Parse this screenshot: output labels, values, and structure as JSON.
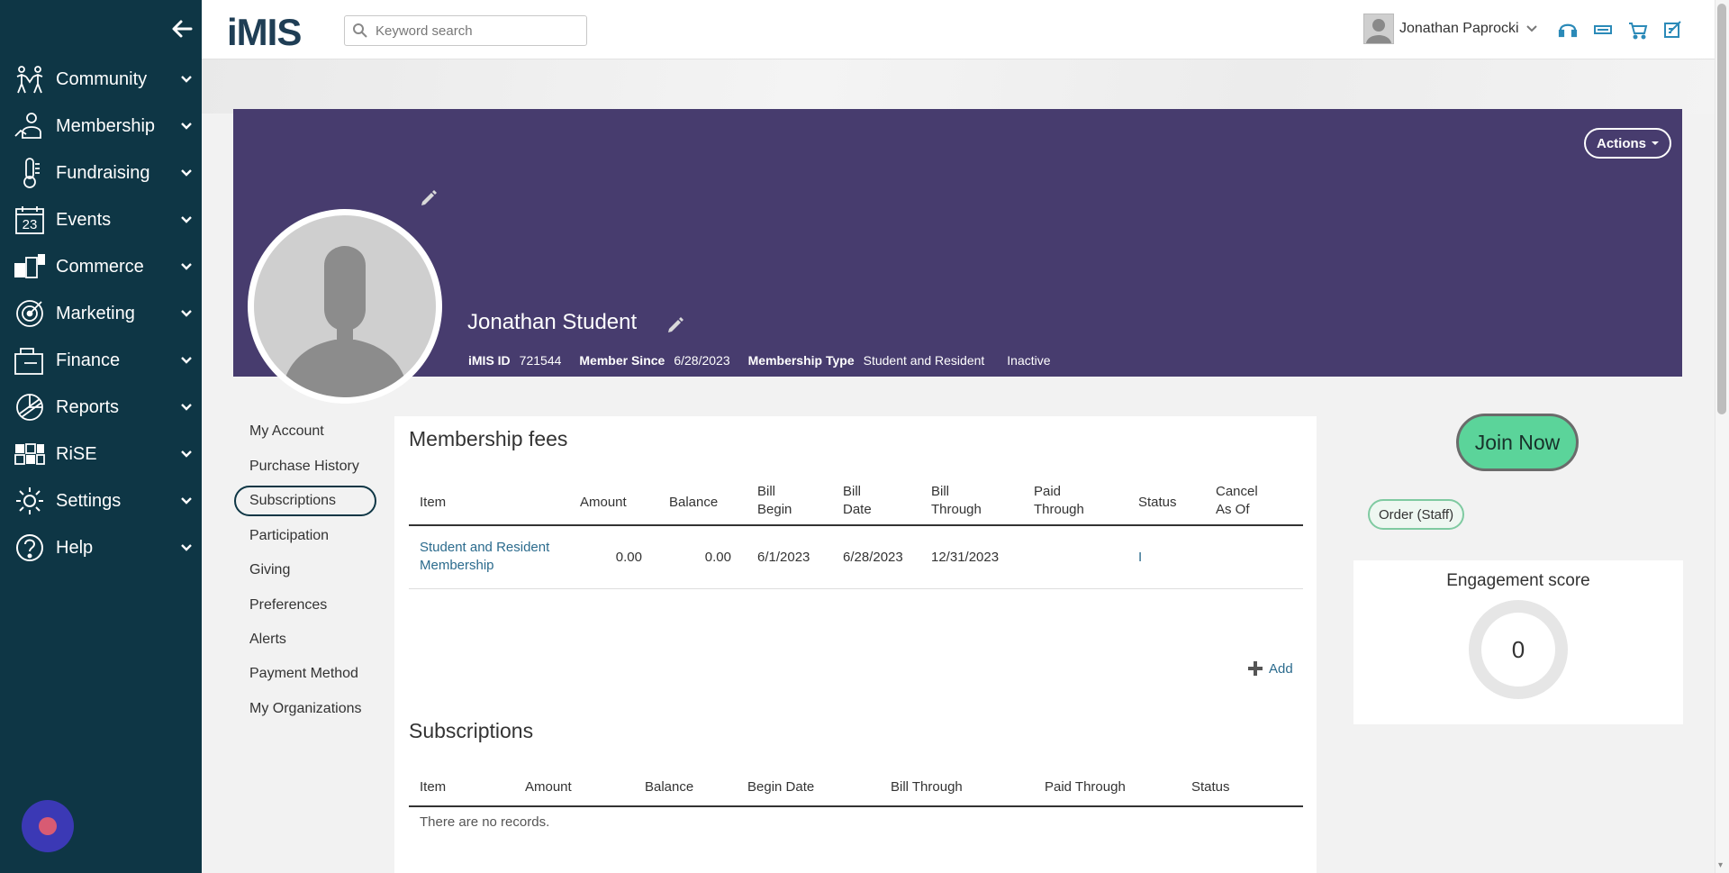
{
  "app": {
    "logo_text": "iMIS"
  },
  "search": {
    "placeholder": "Keyword search"
  },
  "user": {
    "name": "Jonathan Paprocki"
  },
  "sidebar": {
    "items": [
      {
        "label": "Community",
        "icon": "community-icon"
      },
      {
        "label": "Membership",
        "icon": "membership-icon"
      },
      {
        "label": "Fundraising",
        "icon": "fundraising-icon"
      },
      {
        "label": "Events",
        "icon": "calendar-icon",
        "icon_text": "23"
      },
      {
        "label": "Commerce",
        "icon": "commerce-icon"
      },
      {
        "label": "Marketing",
        "icon": "target-icon"
      },
      {
        "label": "Finance",
        "icon": "finance-icon"
      },
      {
        "label": "Reports",
        "icon": "reports-icon"
      },
      {
        "label": "RiSE",
        "icon": "puzzle-icon"
      },
      {
        "label": "Settings",
        "icon": "gear-icon"
      },
      {
        "label": "Help",
        "icon": "help-icon"
      }
    ]
  },
  "profile": {
    "name": "Jonathan Student",
    "actions_label": "Actions",
    "imis_id_label": "iMIS ID",
    "imis_id": "721544",
    "member_since_label": "Member Since",
    "member_since": "6/28/2023",
    "membership_type_label": "Membership Type",
    "membership_type": "Student and Resident",
    "status": "Inactive"
  },
  "profile_nav": {
    "items": [
      "My Account",
      "Purchase History",
      "Subscriptions",
      "Participation",
      "Giving",
      "Preferences",
      "Alerts",
      "Payment Method",
      "My Organizations"
    ],
    "active": "Subscriptions"
  },
  "membership_fees": {
    "title": "Membership fees",
    "headers": {
      "item": "Item",
      "amount": "Amount",
      "balance": "Balance",
      "bill_begin_1": "Bill",
      "bill_begin_2": "Begin",
      "bill_date_1": "Bill",
      "bill_date_2": "Date",
      "bill_through_1": "Bill",
      "bill_through_2": "Through",
      "paid_through_1": "Paid",
      "paid_through_2": "Through",
      "status": "Status",
      "cancel_as_of_1": "Cancel",
      "cancel_as_of_2": "As Of"
    },
    "rows": [
      {
        "item_line1": "Student and Resident",
        "item_line2": "Membership",
        "amount": "0.00",
        "balance": "0.00",
        "bill_begin": "6/1/2023",
        "bill_date": "6/28/2023",
        "bill_through": "12/31/2023",
        "paid_through": "",
        "status": "I",
        "cancel_as_of": ""
      }
    ],
    "add_label": "Add"
  },
  "subscriptions": {
    "title": "Subscriptions",
    "headers": {
      "item": "Item",
      "amount": "Amount",
      "balance": "Balance",
      "begin_date": "Begin Date",
      "bill_through": "Bill Through",
      "paid_through": "Paid Through",
      "status": "Status"
    },
    "empty_text": "There are no records."
  },
  "right_panel": {
    "join_label": "Join Now",
    "order_label": "Order (Staff)",
    "engagement_title": "Engagement score",
    "engagement_score": "0"
  },
  "colors": {
    "sidebar": "#0e3645",
    "banner": "#473c6e",
    "link": "#2b6b8d",
    "join": "#5bd49a",
    "topbar_icons": "#2b8ab8"
  }
}
